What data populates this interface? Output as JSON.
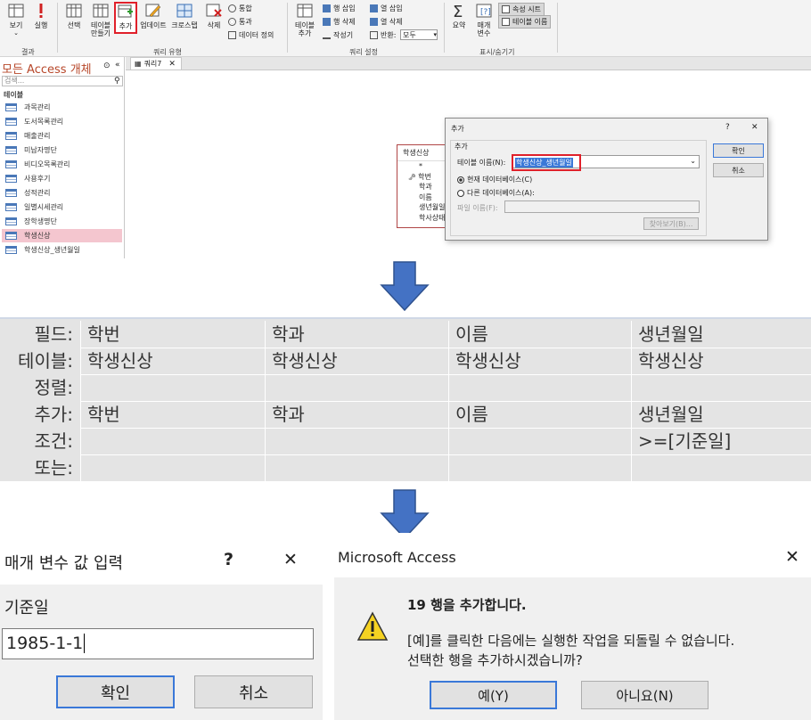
{
  "ribbon": {
    "view": "보기",
    "run": "실행",
    "results_group": "결과",
    "select": "선택",
    "make_table": "테이블\n만들기",
    "append": "추가",
    "update": "업데이트",
    "crosstab": "크로스탭",
    "delete": "삭제",
    "union": "통합",
    "passthrough": "통과",
    "data_def": "데이터 정의",
    "query_type_group": "쿼리 유형",
    "show_table": "테이블\n추가",
    "insert_rows": "행 삽입",
    "delete_rows": "행 삭제",
    "builder": "작성기",
    "insert_cols": "열 삽입",
    "delete_cols": "열 삭제",
    "return_label": "반환:",
    "return_value": "모두",
    "query_setup_group": "쿼리 설정",
    "totals": "요약",
    "parameters": "매개\n변수",
    "property_sheet": "속성 시트",
    "table_names": "테이블 이름",
    "show_hide_group": "표시/숨기기"
  },
  "nav": {
    "title": "모든 Access 개체",
    "search_placeholder": "검색...",
    "category": "테이블",
    "items": [
      "과목관리",
      "도서목록관리",
      "매출관리",
      "미납자명단",
      "비디오목록관리",
      "사용후기",
      "성적관리",
      "일별시세관리",
      "장학생명단",
      "학생신상",
      "학생신상_생년월일"
    ],
    "selected_index": 9
  },
  "doc_tab": "쿼리7",
  "fieldlist": {
    "title": "학생신상",
    "fields": [
      "*",
      "학번",
      "학과",
      "이름",
      "생년월일",
      "학사상태"
    ]
  },
  "append_dialog": {
    "title": "추가",
    "help": "?",
    "close": "✕",
    "group": "추가",
    "table_name_label": "테이블 이름(N):",
    "table_name_value": "학생신상_생년월일",
    "current_db": "현재 데이터베이스(C)",
    "other_db": "다른 데이터베이스(A):",
    "file_name_label": "파일 이름(F):",
    "browse": "찾아보기(B)...",
    "ok": "확인",
    "cancel": "취소"
  },
  "grid": {
    "row_labels": [
      "필드:",
      "테이블:",
      "정렬:",
      "추가:",
      "조건:",
      "또는:"
    ],
    "columns": [
      {
        "field": "학번",
        "table": "학생신상",
        "sort": "",
        "append": "학번",
        "criteria": "",
        "or": ""
      },
      {
        "field": "학과",
        "table": "학생신상",
        "sort": "",
        "append": "학과",
        "criteria": "",
        "or": ""
      },
      {
        "field": "이름",
        "table": "학생신상",
        "sort": "",
        "append": "이름",
        "criteria": "",
        "or": ""
      },
      {
        "field": "생년월일",
        "table": "학생신상",
        "sort": "",
        "append": "생년월일",
        "criteria": ">=[기준일]",
        "or": ""
      }
    ]
  },
  "param_dialog": {
    "title": "매개 변수 값 입력",
    "help": "?",
    "close": "✕",
    "prompt": "기준일",
    "value": "1985-1-1",
    "ok": "확인",
    "cancel": "취소"
  },
  "access_dialog": {
    "title": "Microsoft Access",
    "close": "✕",
    "heading": "19 행을 추가합니다.",
    "line1": "[예]를 클릭한 다음에는 실행한 작업을 되돌릴 수 없습니다.",
    "line2": "선택한 행을 추가하시겠습니까?",
    "yes": "예(Y)",
    "no": "아니요(N)"
  },
  "colors": {
    "accent": "#b7472a",
    "highlight_border": "#e0202a",
    "arrow": "#4472c4"
  }
}
